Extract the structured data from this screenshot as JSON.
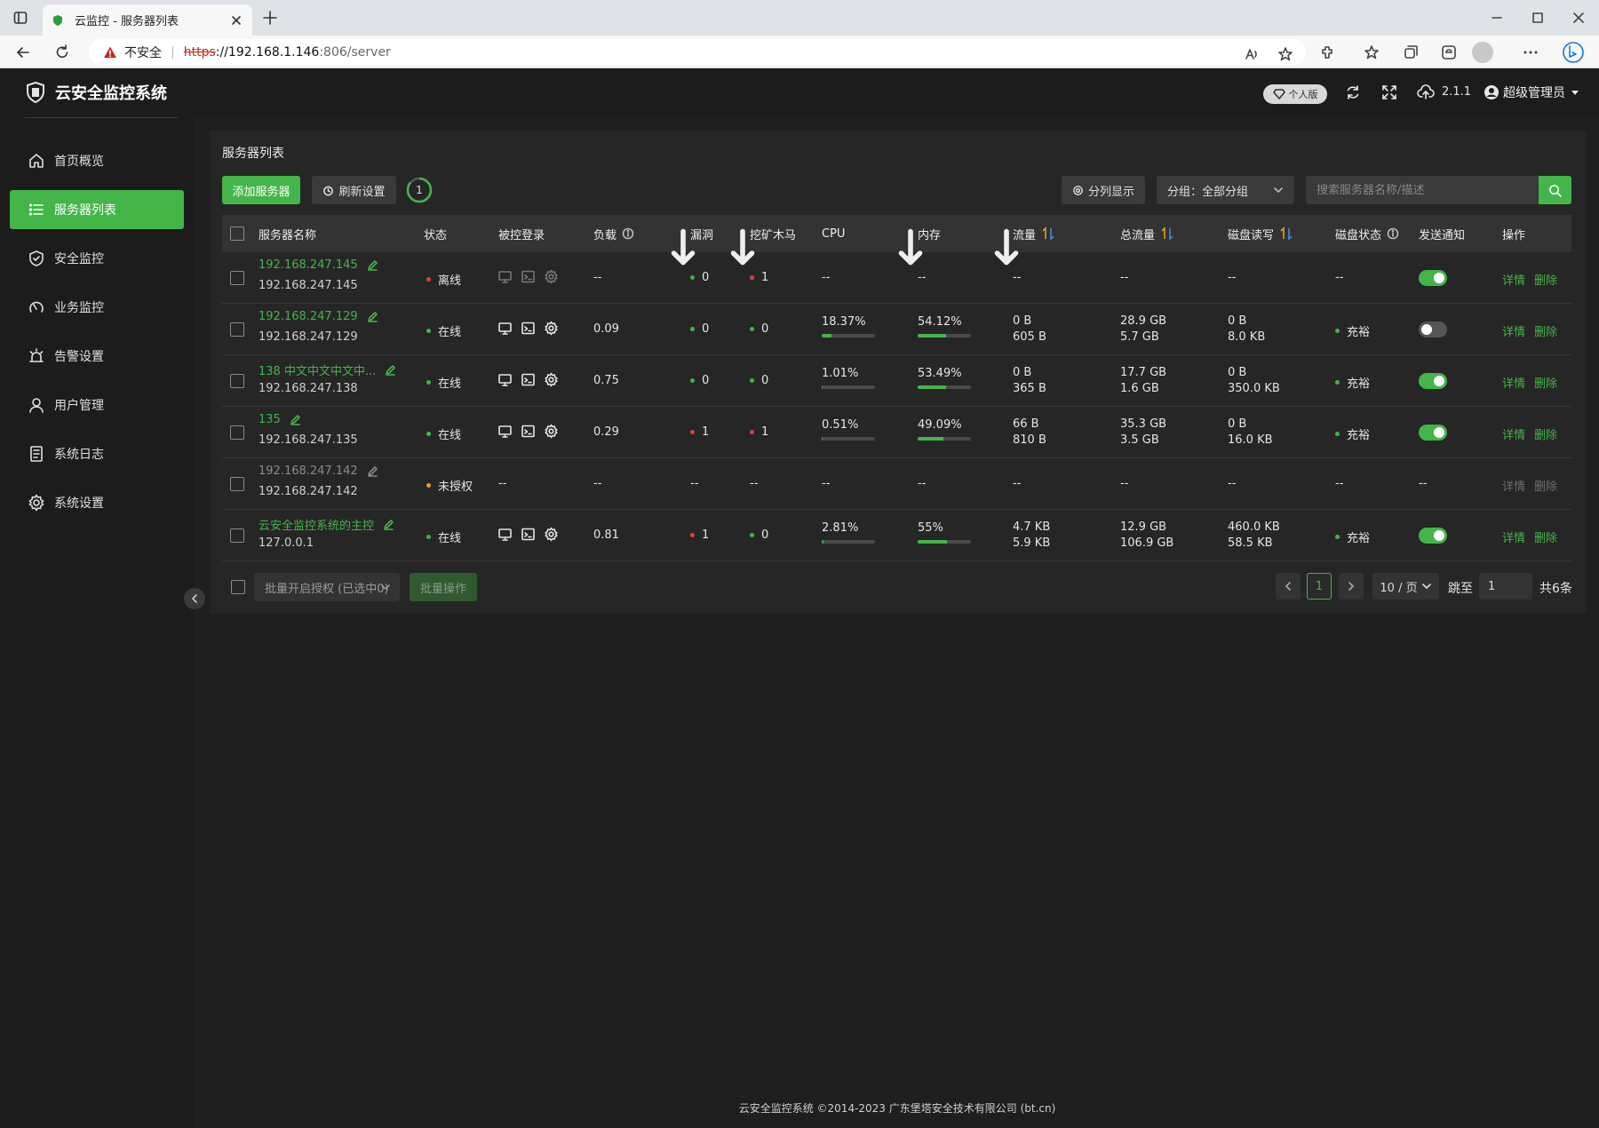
{
  "browser": {
    "tab_title": "云监控 - 服务器列表",
    "security_label": "不安全",
    "url_scheme": "https",
    "url_host": "://192.168.1.146",
    "url_path": ":806/server"
  },
  "header": {
    "brand": "云安全监控系统",
    "edition": "个人版",
    "version": "2.1.1",
    "user": "超级管理员"
  },
  "sidebar": {
    "items": [
      {
        "label": "首页概览",
        "icon": "home-icon"
      },
      {
        "label": "服务器列表",
        "icon": "list-icon",
        "active": true
      },
      {
        "label": "安全监控",
        "icon": "shield-icon"
      },
      {
        "label": "业务监控",
        "icon": "gauge-icon"
      },
      {
        "label": "告警设置",
        "icon": "alarm-icon"
      },
      {
        "label": "用户管理",
        "icon": "user-icon"
      },
      {
        "label": "系统日志",
        "icon": "log-icon"
      },
      {
        "label": "系统设置",
        "icon": "gear-icon"
      }
    ]
  },
  "toolbar": {
    "title": "服务器列表",
    "add_label": "添加服务器",
    "refresh_label": "刷新设置",
    "countdown": "1",
    "columns_label": "分列显示",
    "group_label": "分组：全部分组",
    "search_placeholder": "搜索服务器名称/描述"
  },
  "table": {
    "headers": {
      "name": "服务器名称",
      "status": "状态",
      "login": "被控登录",
      "load": "负载",
      "vuln": "漏洞",
      "miner": "挖矿木马",
      "cpu": "CPU",
      "mem": "内存",
      "traffic": "流量",
      "total_traffic": "总流量",
      "disk_io": "磁盘读写",
      "disk_status": "磁盘状态",
      "notify": "发送通知",
      "ops": "操作"
    },
    "rows": [
      {
        "name": "192.168.247.145",
        "ip": "192.168.247.145",
        "status": "离线",
        "status_color": "#e0413a",
        "login_enabled": false,
        "load": "--",
        "vuln": "0",
        "vuln_color": "#44b549",
        "miner": "1",
        "miner_color": "#e0413a",
        "cpu": "--",
        "cpu_pct": null,
        "mem": "--",
        "mem_pct": null,
        "traffic_up": "--",
        "traffic_down": "",
        "total_up": "--",
        "total_down": "",
        "disk_r": "--",
        "disk_w": "",
        "disk_status": "--",
        "notify": true,
        "detail": "详情",
        "delete": "删除"
      },
      {
        "name": "192.168.247.129",
        "ip": "192.168.247.129",
        "status": "在线",
        "status_color": "#44b549",
        "login_enabled": true,
        "load": "0.09",
        "vuln": "0",
        "vuln_color": "#44b549",
        "miner": "0",
        "miner_color": "#44b549",
        "cpu": "18.37%",
        "cpu_pct": 18.37,
        "mem": "54.12%",
        "mem_pct": 54.12,
        "traffic_up": "0 B",
        "traffic_down": "605 B",
        "total_up": "28.9 GB",
        "total_down": "5.7 GB",
        "disk_r": "0 B",
        "disk_w": "8.0 KB",
        "disk_status": "充裕",
        "notify": false,
        "detail": "详情",
        "delete": "删除"
      },
      {
        "name": "138 中文中文中文中...",
        "ip": "192.168.247.138",
        "status": "在线",
        "status_color": "#44b549",
        "login_enabled": true,
        "load": "0.75",
        "vuln": "0",
        "vuln_color": "#44b549",
        "miner": "0",
        "miner_color": "#44b549",
        "cpu": "1.01%",
        "cpu_pct": 1.01,
        "mem": "53.49%",
        "mem_pct": 53.49,
        "traffic_up": "0 B",
        "traffic_down": "365 B",
        "total_up": "17.7 GB",
        "total_down": "1.6 GB",
        "disk_r": "0 B",
        "disk_w": "350.0 KB",
        "disk_status": "充裕",
        "notify": true,
        "detail": "详情",
        "delete": "删除"
      },
      {
        "name": "135",
        "ip": "192.168.247.135",
        "status": "在线",
        "status_color": "#44b549",
        "login_enabled": true,
        "load": "0.29",
        "vuln": "1",
        "vuln_color": "#e0413a",
        "miner": "1",
        "miner_color": "#e0413a",
        "cpu": "0.51%",
        "cpu_pct": 0.51,
        "mem": "49.09%",
        "mem_pct": 49.09,
        "traffic_up": "66 B",
        "traffic_down": "810 B",
        "total_up": "35.3 GB",
        "total_down": "3.5 GB",
        "disk_r": "0 B",
        "disk_w": "16.0 KB",
        "disk_status": "充裕",
        "notify": true,
        "detail": "详情",
        "delete": "删除"
      },
      {
        "name": "192.168.247.142",
        "ip": "192.168.247.142",
        "status": "未授权",
        "status_color": "#e69a2c",
        "login_enabled": null,
        "load": "--",
        "vuln": "--",
        "vuln_color": null,
        "miner": "--",
        "miner_color": null,
        "cpu": "--",
        "cpu_pct": null,
        "mem": "--",
        "mem_pct": null,
        "traffic_up": "--",
        "traffic_down": "",
        "total_up": "--",
        "total_down": "",
        "disk_r": "--",
        "disk_w": "",
        "disk_status": "--",
        "notify": null,
        "login_text": "--",
        "notify_text": "--",
        "detail": "详情",
        "delete": "删除",
        "muted": true
      },
      {
        "name": "云安全监控系统的主控",
        "ip": "127.0.0.1",
        "status": "在线",
        "status_color": "#44b549",
        "login_enabled": true,
        "load": "0.81",
        "vuln": "1",
        "vuln_color": "#e0413a",
        "miner": "0",
        "miner_color": "#44b549",
        "cpu": "2.81%",
        "cpu_pct": 2.81,
        "mem": "55%",
        "mem_pct": 55,
        "traffic_up": "4.7 KB",
        "traffic_down": "5.9 KB",
        "total_up": "12.9 GB",
        "total_down": "106.9 GB",
        "disk_r": "460.0 KB",
        "disk_w": "58.5 KB",
        "disk_status": "充裕",
        "notify": true,
        "detail": "详情",
        "delete": "删除"
      }
    ]
  },
  "footer": {
    "batch_select": "批量开启授权 (已选中0)",
    "batch_button": "批量操作",
    "page": "1",
    "page_size": "10 / 页",
    "jump_label": "跳至",
    "jump_value": "1",
    "total": "共6条",
    "copyright": "云安全监控系统 ©2014-2023 广东堡塔安全技术有限公司 (bt.cn)"
  }
}
